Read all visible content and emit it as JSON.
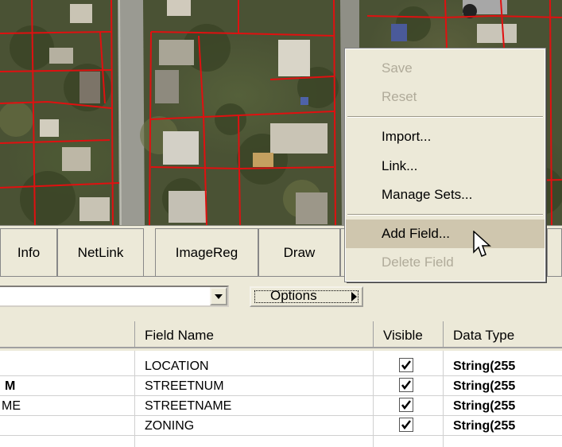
{
  "tabs": [
    {
      "label": "Info"
    },
    {
      "label": "NetLink"
    },
    {
      "label": "ImageReg"
    },
    {
      "label": "Draw"
    }
  ],
  "options_button": {
    "label": "Options"
  },
  "columns": [
    {
      "label": ""
    },
    {
      "label": "Field Name"
    },
    {
      "label": "Visible"
    },
    {
      "label": "Data Type"
    }
  ],
  "rows": [
    {
      "alias": "",
      "field": "LOCATION",
      "visible": true,
      "type": "String(255"
    },
    {
      "alias": "M",
      "field": "STREETNUM",
      "visible": true,
      "type": "String(255"
    },
    {
      "alias": "ME",
      "field": "STREETNAME",
      "visible": true,
      "type": "String(255"
    },
    {
      "alias": "",
      "field": "ZONING",
      "visible": true,
      "type": "String(255"
    }
  ],
  "menu": {
    "items": [
      {
        "label": "Save",
        "enabled": false
      },
      {
        "label": "Reset",
        "enabled": false
      },
      {
        "label": "Import...",
        "enabled": true
      },
      {
        "label": "Link...",
        "enabled": true
      },
      {
        "label": "Manage Sets...",
        "enabled": true
      },
      {
        "label": "Add Field...",
        "enabled": true,
        "highlighted": true
      },
      {
        "label": "Delete Field",
        "enabled": false
      }
    ]
  },
  "colors": {
    "parcel_lines": "#e01010",
    "menu_highlight": "#cfc6ae",
    "disabled_text": "#b0ab9a"
  }
}
